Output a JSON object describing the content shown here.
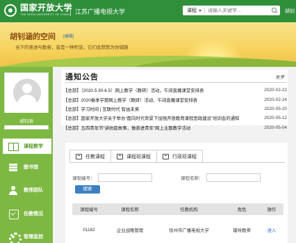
{
  "header": {
    "logo_cn": "国家开放大学",
    "logo_en": "THE OPEN UNIVERSITY OF CHINA",
    "org_name": "江苏广播电视大学",
    "search_category": "课程",
    "search_placeholder": "请输入关键字...",
    "user_short": "胡钊"
  },
  "banner": {
    "space_title": "胡钊涵的空间",
    "edit_label": "[编辑]",
    "motto": "当下的奋进与勤奋，皆是一种积淀，它们会默默为你铺路"
  },
  "sidebar": {
    "user_name": "胡钊涵",
    "items": [
      {
        "label": "课程教学",
        "icon": "book-icon",
        "active": true
      },
      {
        "label": "图书馆",
        "icon": "library-icon",
        "active": false
      },
      {
        "label": "教师团队",
        "icon": "team-icon",
        "active": false
      },
      {
        "label": "任教情况",
        "icon": "tasks-icon",
        "active": false
      },
      {
        "label": "管理监控",
        "icon": "gear-icon",
        "active": false
      }
    ]
  },
  "notice": {
    "title": "通知公告",
    "more_label": "更多",
    "items": [
      {
        "text": "【总部】（2020.5.30-6.5）网上教学（教研）活动，午间直播课堂安排表",
        "date": "2020-02-22"
      },
      {
        "text": "【总部】2020春季学期网上教学（教研）活动、午间直播课堂安排表",
        "date": "2020-02-24"
      },
      {
        "text": "【总部】学习时间 | 互联时代 智由未来",
        "date": "2020-05-20"
      },
      {
        "text": "【总部】国家开放大学关于举办“面向时代背景下加强开放教育课程思政建设”培训会的通知",
        "date": "2020-05-12"
      },
      {
        "text": "【总部】五四青年节“讲抗疫故事，做奋进青年”网上主题教学活动",
        "date": "2020-05-04"
      }
    ]
  },
  "course": {
    "tabs": [
      {
        "label": "任教课程",
        "active": true
      },
      {
        "label": "课程班课程",
        "active": false
      },
      {
        "label": "行政班课程",
        "active": false
      }
    ],
    "form": {
      "code_label": "课程编号：",
      "name_label": "课程名称：",
      "search_button": "搜索"
    },
    "table": {
      "columns": [
        "课程编号",
        "课程名称",
        "任教机构",
        "角色",
        "操作"
      ],
      "rows": [
        {
          "code": "01182",
          "name": "企业战略管理",
          "org": "徐州市广播电视大学",
          "role": "辅导教师",
          "action": "进入"
        }
      ]
    }
  }
}
